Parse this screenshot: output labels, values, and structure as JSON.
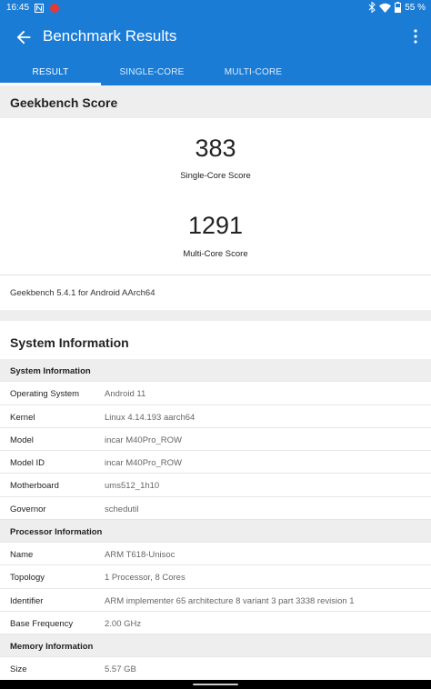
{
  "status_bar": {
    "time": "16:45",
    "battery": "55 %",
    "icons": [
      "notification-n-icon",
      "app-notification-icon",
      "bluetooth-icon",
      "wifi-icon",
      "battery-icon"
    ]
  },
  "app_bar": {
    "title": "Benchmark Results",
    "tabs": [
      {
        "label": "RESULT"
      },
      {
        "label": "SINGLE-CORE"
      },
      {
        "label": "MULTI-CORE"
      }
    ],
    "active_tab": "RESULT",
    "color": "#1b7cd6"
  },
  "geekbench": {
    "header": "Geekbench Score",
    "single_score": "383",
    "single_label": "Single-Core Score",
    "multi_score": "1291",
    "multi_label": "Multi-Core Score",
    "version": "Geekbench 5.4.1 for Android AArch64"
  },
  "system_info": {
    "title": "System Information",
    "rows": [
      {
        "group": "System Information"
      },
      {
        "key": "Operating System",
        "value": "Android 11"
      },
      {
        "key": "Kernel",
        "value": "Linux 4.14.193 aarch64"
      },
      {
        "key": "Model",
        "value": "incar M40Pro_ROW"
      },
      {
        "key": "Model ID",
        "value": "incar M40Pro_ROW"
      },
      {
        "key": "Motherboard",
        "value": "ums512_1h10"
      },
      {
        "key": "Governor",
        "value": "schedutil"
      },
      {
        "group": "Processor Information"
      },
      {
        "key": "Name",
        "value": "ARM T618-Unisoc"
      },
      {
        "key": "Topology",
        "value": "1 Processor, 8 Cores"
      },
      {
        "key": "Identifier",
        "value": "ARM implementer 65 architecture 8 variant 3 part 3338 revision 1"
      },
      {
        "key": "Base Frequency",
        "value": "2.00 GHz"
      },
      {
        "group": "Memory Information"
      },
      {
        "key": "Size",
        "value": "5.57 GB"
      }
    ]
  }
}
